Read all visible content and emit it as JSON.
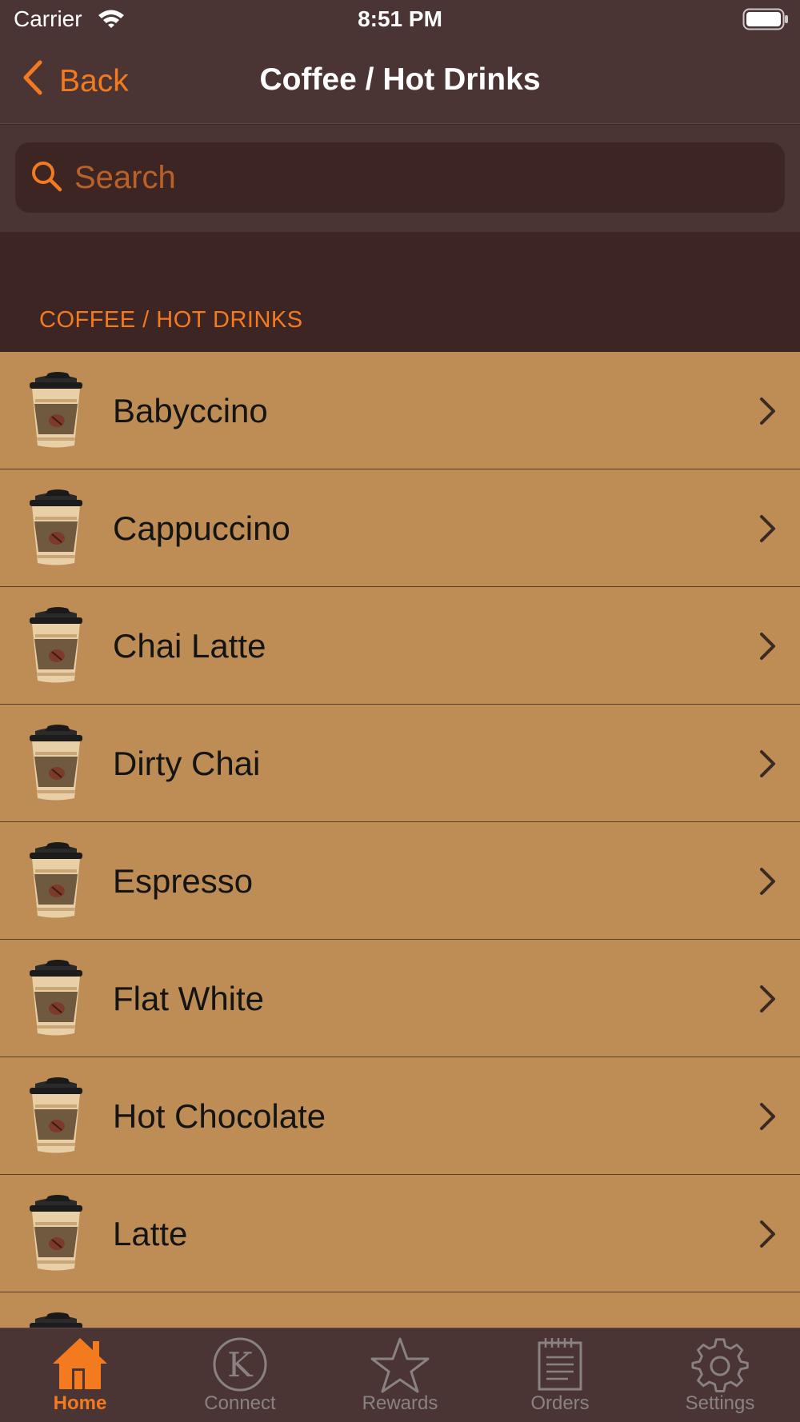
{
  "status_bar": {
    "carrier": "Carrier",
    "time": "8:51 PM"
  },
  "nav": {
    "back_label": "Back",
    "title": "Coffee / Hot Drinks"
  },
  "search": {
    "placeholder": "Search",
    "value": ""
  },
  "section": {
    "title": "COFFEE / HOT DRINKS"
  },
  "items": [
    {
      "label": "Babyccino"
    },
    {
      "label": "Cappuccino"
    },
    {
      "label": "Chai Latte"
    },
    {
      "label": "Dirty Chai"
    },
    {
      "label": "Espresso"
    },
    {
      "label": "Flat White"
    },
    {
      "label": "Hot Chocolate"
    },
    {
      "label": "Latte"
    },
    {
      "label": ""
    }
  ],
  "tabs": [
    {
      "label": "Home",
      "icon": "home-icon",
      "active": true
    },
    {
      "label": "Connect",
      "icon": "k-logo-icon",
      "active": false
    },
    {
      "label": "Rewards",
      "icon": "star-icon",
      "active": false
    },
    {
      "label": "Orders",
      "icon": "notepad-icon",
      "active": false
    },
    {
      "label": "Settings",
      "icon": "gear-icon",
      "active": false
    }
  ],
  "colors": {
    "accent": "#f47a20",
    "bar_background": "#4a3534",
    "section_background": "#3d2523",
    "row_background": "#be8d55",
    "inactive_tab": "#8a8282"
  }
}
